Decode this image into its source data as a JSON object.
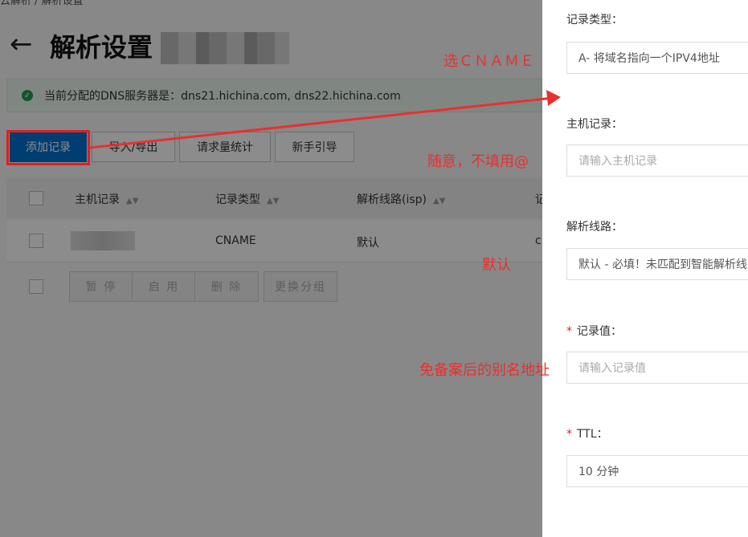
{
  "page": {
    "breadcrumb": "云解析 / 解析设置",
    "back_icon": "arrow-left-icon",
    "title": "解析设置",
    "notice": {
      "icon": "check-circle-icon",
      "text": "当前分配的DNS服务器是：dns21.hichina.com, dns22.hichina.com"
    },
    "toolbar": {
      "add": "添加记录",
      "import_export": "导入/导出",
      "stats": "请求量统计",
      "guide": "新手引导"
    },
    "table": {
      "headers": [
        "主机记录",
        "记录类型",
        "解析线路(isp)",
        "记"
      ],
      "rows": [
        {
          "host": "",
          "type": "CNAME",
          "line": "默认",
          "value": "c"
        }
      ]
    },
    "bulk": {
      "pause": "暂 停",
      "enable": "启 用",
      "delete": "删 除",
      "group": "更换分组"
    }
  },
  "annotations": {
    "cname": "选ＣＮＡＭＥ",
    "host": "随意，不填用@",
    "line": "默认",
    "value": "免备案后的别名地址",
    "color": "#e83030"
  },
  "panel": {
    "record_type": {
      "label": "记录类型：",
      "value": "A- 将域名指向一个IPV4地址"
    },
    "host_record": {
      "label": "主机记录：",
      "placeholder": "请输入主机记录"
    },
    "line": {
      "label": "解析线路：",
      "value": "默认 - 必填！未匹配到智能解析线"
    },
    "record_value": {
      "required": "*",
      "label": "记录值：",
      "placeholder": "请输入记录值"
    },
    "ttl": {
      "required": "*",
      "label": "TTL：",
      "value": "10 分钟"
    }
  }
}
